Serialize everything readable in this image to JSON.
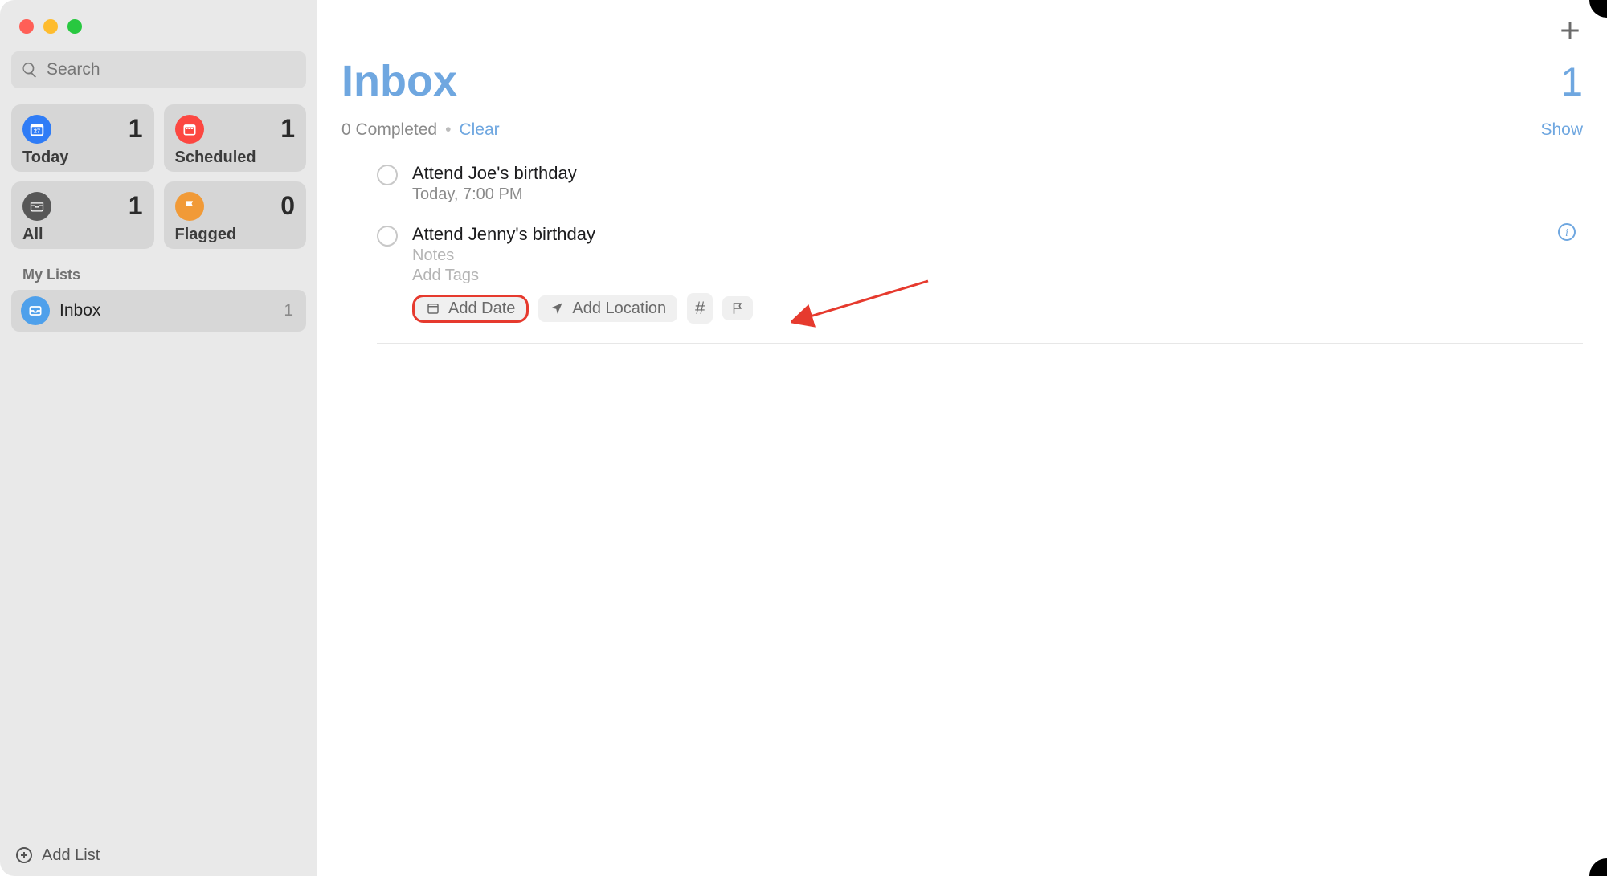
{
  "sidebar": {
    "search_placeholder": "Search",
    "tiles": [
      {
        "label": "Today",
        "count": "1",
        "icon": "calendar-today",
        "color": "#2f7cf6"
      },
      {
        "label": "Scheduled",
        "count": "1",
        "icon": "calendar",
        "color": "#fc4741"
      },
      {
        "label": "All",
        "count": "1",
        "icon": "tray",
        "color": "#575757"
      },
      {
        "label": "Flagged",
        "count": "0",
        "icon": "flag",
        "color": "#f19a37"
      }
    ],
    "lists_header": "My Lists",
    "lists": [
      {
        "name": "Inbox",
        "count": "1",
        "icon": "tray",
        "color": "#4ea0eb"
      }
    ],
    "add_list_label": "Add List"
  },
  "main": {
    "title": "Inbox",
    "count": "1",
    "completed_text": "0 Completed",
    "clear_label": "Clear",
    "show_label": "Show",
    "reminders": [
      {
        "title": "Attend Joe's birthday",
        "subtitle": "Today, 7:00 PM",
        "expanded": false
      },
      {
        "title": "Attend Jenny's birthday",
        "notes_placeholder": "Notes",
        "tags_placeholder": "Add Tags",
        "expanded": true,
        "chips": {
          "add_date": "Add Date",
          "add_location": "Add Location",
          "tag_symbol": "#",
          "flag": "flag"
        }
      }
    ]
  }
}
